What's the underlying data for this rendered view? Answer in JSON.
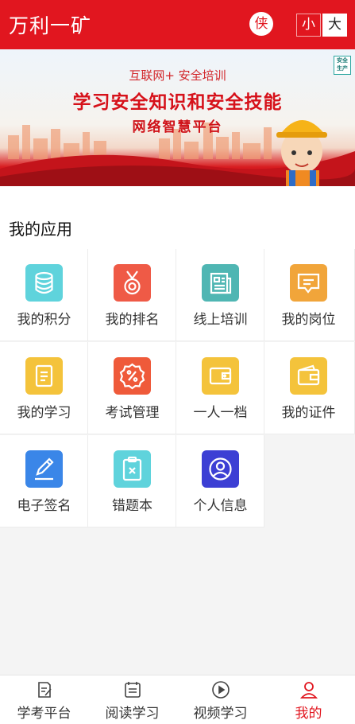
{
  "header": {
    "title": "万利一矿",
    "avatar_text": "侠",
    "font_small": "小",
    "font_large": "大"
  },
  "banner": {
    "subtitle": "互联网+ 安全培训",
    "title": "学习安全知识和安全技能",
    "title2": "网络智慧平台",
    "badge": "安全 生产"
  },
  "section": {
    "title": "我的应用"
  },
  "apps": [
    {
      "label": "我的积分",
      "icon": "coins-stack-icon",
      "color": "#5fd3dc"
    },
    {
      "label": "我的排名",
      "icon": "medal-icon",
      "color": "#ef5a46"
    },
    {
      "label": "线上培训",
      "icon": "newspaper-icon",
      "color": "#4fb6b3"
    },
    {
      "label": "我的岗位",
      "icon": "message-box-icon",
      "color": "#f1a53a"
    },
    {
      "label": "我的学习",
      "icon": "document-icon",
      "color": "#f4c33b"
    },
    {
      "label": "考试管理",
      "icon": "percent-badge-icon",
      "color": "#ef5a3a"
    },
    {
      "label": "一人一档",
      "icon": "wallet-icon",
      "color": "#f4c33b"
    },
    {
      "label": "我的证件",
      "icon": "card-wallet-icon",
      "color": "#f4c33b"
    },
    {
      "label": "电子签名",
      "icon": "pen-icon",
      "color": "#3a86e8"
    },
    {
      "label": "错题本",
      "icon": "clipboard-x-icon",
      "color": "#5fd3dc"
    },
    {
      "label": "个人信息",
      "icon": "user-circle-icon",
      "color": "#3c3fd4"
    }
  ],
  "nav": [
    {
      "label": "学考平台",
      "icon": "edit-doc-icon",
      "active": false
    },
    {
      "label": "阅读学习",
      "icon": "list-doc-icon",
      "active": false
    },
    {
      "label": "视频学习",
      "icon": "play-circle-icon",
      "active": false
    },
    {
      "label": "我的",
      "icon": "person-icon",
      "active": true
    }
  ],
  "colors": {
    "brand": "#e1161f"
  }
}
